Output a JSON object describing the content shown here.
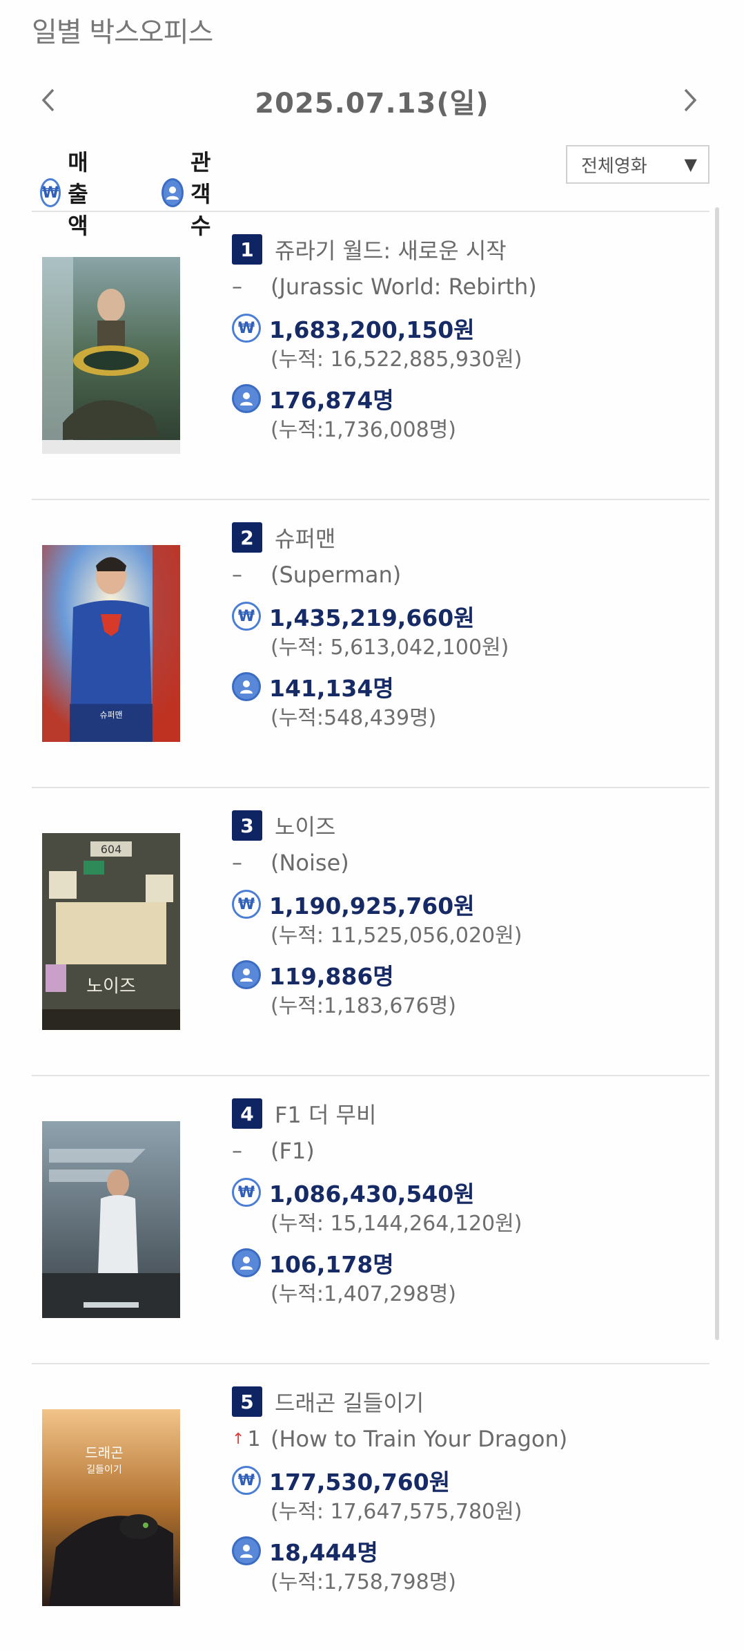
{
  "header": {
    "title": "일별 박스오피스"
  },
  "date_nav": {
    "date": "2025.07.13(일)",
    "prev_icon": "chevron-left-icon",
    "next_icon": "chevron-right-icon"
  },
  "toggles": {
    "sales_label": "매출액",
    "audience_label": "관객수",
    "sales_icon": "won-icon",
    "audience_icon": "user-icon"
  },
  "filter": {
    "selected": "전체영화",
    "caret": "▼"
  },
  "colors": {
    "rank_badge": "#0f2463",
    "stat_text": "#162a66",
    "icon_blue": "#4a7ed4",
    "up_arrow": "#e03a3a"
  },
  "movies": [
    {
      "rank": "1",
      "title_kr": "쥬라기 월드: 새로운 시작",
      "change": "–",
      "title_en": "(Jurassic World: Rebirth)",
      "sales": "1,683,200,150원",
      "sales_total": "(누적: 16,522,885,930원)",
      "audience": "176,874명",
      "audience_total": "(누적:1,736,008명)"
    },
    {
      "rank": "2",
      "title_kr": "슈퍼맨",
      "change": "–",
      "title_en": "(Superman)",
      "sales": "1,435,219,660원",
      "sales_total": "(누적: 5,613,042,100원)",
      "audience": "141,134명",
      "audience_total": "(누적:548,439명)"
    },
    {
      "rank": "3",
      "title_kr": "노이즈",
      "change": "–",
      "title_en": "(Noise)",
      "sales": "1,190,925,760원",
      "sales_total": "(누적: 11,525,056,020원)",
      "audience": "119,886명",
      "audience_total": "(누적:1,183,676명)"
    },
    {
      "rank": "4",
      "title_kr": "F1 더 무비",
      "change": "–",
      "title_en": "(F1)",
      "sales": "1,086,430,540원",
      "sales_total": "(누적: 15,144,264,120원)",
      "audience": "106,178명",
      "audience_total": "(누적:1,407,298명)"
    },
    {
      "rank": "5",
      "title_kr": "드래곤 길들이기",
      "change": "1",
      "change_dir": "up",
      "title_en": "(How to Train Your Dragon)",
      "sales": "177,530,760원",
      "sales_total": "(누적: 17,647,575,780원)",
      "audience": "18,444명",
      "audience_total": "(누적:1,758,798명)"
    }
  ]
}
